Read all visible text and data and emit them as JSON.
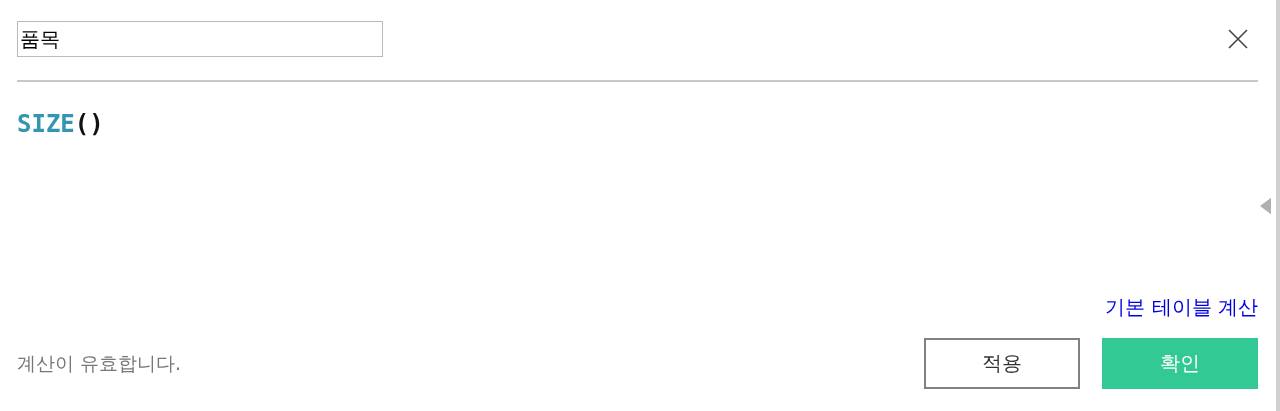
{
  "name_field": {
    "value": "품목"
  },
  "formula": [
    {
      "kind": "function",
      "text": "SIZE"
    },
    {
      "kind": "punct",
      "text": "()"
    }
  ],
  "default_table_link": "기본 테이블 계산",
  "status": "계산이 유효합니다.",
  "buttons": [
    {
      "kind": "secondary",
      "label": "적용"
    },
    {
      "kind": "primary",
      "label": "확인"
    }
  ]
}
